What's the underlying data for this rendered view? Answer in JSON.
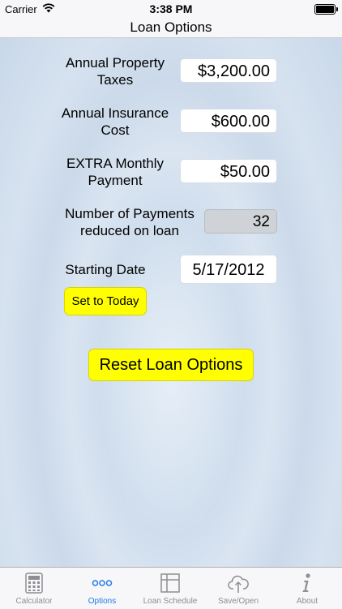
{
  "status_bar": {
    "carrier": "Carrier",
    "time": "3:38 PM"
  },
  "nav": {
    "title": "Loan Options"
  },
  "form": {
    "property_taxes": {
      "label_line1": "Annual Property",
      "label_line2": "Taxes",
      "value": "$3,200.00"
    },
    "insurance": {
      "label_line1": "Annual Insurance",
      "label_line2": "Cost",
      "value": "$600.00"
    },
    "extra_payment": {
      "label_line1": "EXTRA Monthly",
      "label_line2": "Payment",
      "value": "$50.00"
    },
    "payments_reduced": {
      "label_line1": "Number of Payments",
      "label_line2": "reduced on loan",
      "value": "32"
    },
    "starting_date": {
      "label": "Starting Date",
      "value": "5/17/2012"
    },
    "set_today_label": "Set to Today",
    "reset_label": "Reset Loan Options"
  },
  "tabs": [
    {
      "label": "Calculator",
      "icon": "calculator-icon"
    },
    {
      "label": "Options",
      "icon": "ellipsis-icon"
    },
    {
      "label": "Loan Schedule",
      "icon": "table-icon"
    },
    {
      "label": "Save/Open",
      "icon": "cloud-upload-icon"
    },
    {
      "label": "About",
      "icon": "info-icon"
    }
  ],
  "colors": {
    "accent": "#1f7ae6",
    "button_yellow": "#ffff00",
    "inactive_tab": "#8e8e93"
  },
  "active_tab": "Options"
}
